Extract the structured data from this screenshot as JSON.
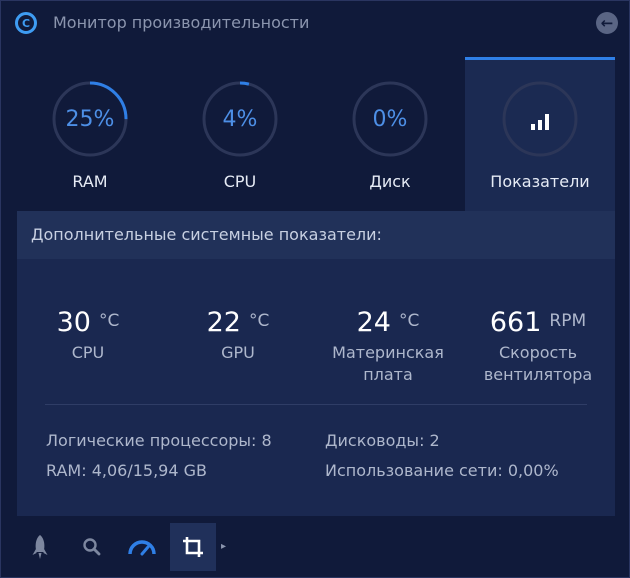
{
  "window": {
    "title": "Монитор производительности"
  },
  "gauges": [
    {
      "value": "25%",
      "label": "RAM",
      "percent": 25
    },
    {
      "value": "4%",
      "label": "CPU",
      "percent": 4
    },
    {
      "value": "0%",
      "label": "Диск",
      "percent": 0
    }
  ],
  "indicators_tab": {
    "label": "Показатели"
  },
  "panel": {
    "header": "Дополнительные системные показатели:",
    "stats": [
      {
        "value": "30",
        "unit": "°C",
        "label_line1": "CPU",
        "label_line2": ""
      },
      {
        "value": "22",
        "unit": "°C",
        "label_line1": "GPU",
        "label_line2": ""
      },
      {
        "value": "24",
        "unit": "°C",
        "label_line1": "Материнская",
        "label_line2": "плата"
      },
      {
        "value": "661",
        "unit": "RPM",
        "label_line1": "Скорость",
        "label_line2": "вентилятора"
      }
    ],
    "info": {
      "logical_processors": "Логические процессоры: 8",
      "drives": "Дисководы: 2",
      "ram": "RAM: 4,06/15,94 GB",
      "network": "Использование сети: 0,00%"
    }
  },
  "colors": {
    "accent": "#2f7fe6",
    "ring_track": "#2c3658",
    "background": "#101a3a",
    "panel": "#1a2850"
  },
  "toolbar": {
    "icons": [
      "rocket-icon",
      "search-icon",
      "speedometer-icon",
      "crop-icon"
    ]
  }
}
